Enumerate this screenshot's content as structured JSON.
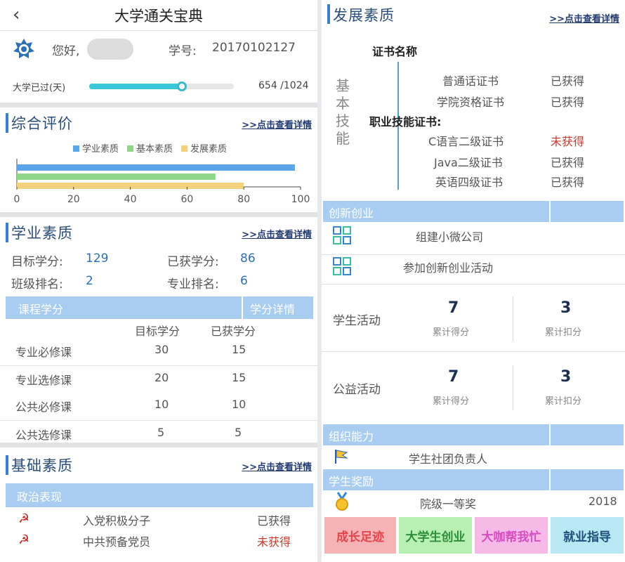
{
  "header": {
    "title": "大学通关宝典",
    "back_icon": "‹"
  },
  "user": {
    "greeting": "您好,",
    "id_label": "学号:",
    "id_value": "20170102127"
  },
  "progress": {
    "label": "大学已过(天)",
    "text": "654 /1024",
    "fraction": 0.6387
  },
  "overall": {
    "title": "综合评价",
    "link": ">>点击查看详情",
    "chart_data": {
      "type": "bar",
      "orientation": "horizontal",
      "series": [
        {
          "name": "学业素质",
          "value": 98,
          "color": "#5aa6e8"
        },
        {
          "name": "基本素质",
          "value": 70,
          "color": "#8fd68a"
        },
        {
          "name": "发展素质",
          "value": 80,
          "color": "#f2d27c"
        }
      ],
      "xlim": [
        0,
        100
      ],
      "xticks": [
        "0",
        "20",
        "40",
        "60",
        "80",
        "100"
      ],
      "legend": "top"
    }
  },
  "academic": {
    "title": "学业素质",
    "link": ">>点击查看详情",
    "target_label": "目标学分:",
    "target_value": "129",
    "earned_label": "已获学分:",
    "earned_value": "86",
    "class_rank_label": "班级排名:",
    "class_rank_value": "2",
    "major_rank_label": "专业排名:",
    "major_rank_value": "6",
    "band_left": "课程学分",
    "band_right": "学分详情",
    "col_target": "目标学分",
    "col_earned": "已获学分",
    "rows": [
      {
        "name": "专业必修课",
        "target": "30",
        "earned": "15"
      },
      {
        "name": "专业选修课",
        "target": "20",
        "earned": "15"
      },
      {
        "name": "公共必修课",
        "target": "10",
        "earned": "10"
      },
      {
        "name": "公共选修课",
        "target": "5",
        "earned": "5"
      }
    ]
  },
  "basic": {
    "title": "基础素质",
    "link": ">>点击查看详情",
    "band": "政治表现",
    "rows": [
      {
        "name": "入党积极分子",
        "status": "已获得"
      },
      {
        "name": "中共预备党员",
        "status": "未获得"
      }
    ]
  },
  "development": {
    "title": "发展素质",
    "link": ">>点击查看详情",
    "cert_header": "证书名称",
    "group_label": [
      "基",
      "本",
      "技",
      "能"
    ],
    "certs1": [
      {
        "name": "普通话证书",
        "status": "已获得"
      },
      {
        "name": "学院资格证书",
        "status": "已获得"
      }
    ],
    "vocational_label": "职业技能证书:",
    "certs2": [
      {
        "name": "C语言二级证书",
        "status": "未获得"
      },
      {
        "name": "Java二级证书",
        "status": "已获得"
      },
      {
        "name": "英语四级证书",
        "status": "已获得"
      }
    ]
  },
  "innovation": {
    "band": "创新创业",
    "items": [
      "组建小微公司",
      "参加创新创业活动"
    ]
  },
  "activities": [
    {
      "label": "学生活动",
      "score": "7",
      "score_label": "累计得分",
      "deduct": "3",
      "deduct_label": "累计扣分"
    },
    {
      "label": "公益活动",
      "score": "7",
      "score_label": "累计得分",
      "deduct": "3",
      "deduct_label": "累计扣分"
    }
  ],
  "organization": {
    "band": "组织能力",
    "item": "学生社团负责人"
  },
  "awards": {
    "band": "学生奖励",
    "item": "院级一等奖",
    "year": "2018"
  },
  "tabs": [
    {
      "label": "成长足迹",
      "bg": "#f5b3b5",
      "color": "#e0474c"
    },
    {
      "label": "大学生创业",
      "bg": "#b8f0b4",
      "color": "#2e8f3a"
    },
    {
      "label": "大咖帮我忙",
      "bg": "#f6b9e8",
      "color": "#d54fc0"
    },
    {
      "label": "就业指导",
      "bg": "#b7e8f3",
      "color": "#1d4f7a"
    }
  ]
}
